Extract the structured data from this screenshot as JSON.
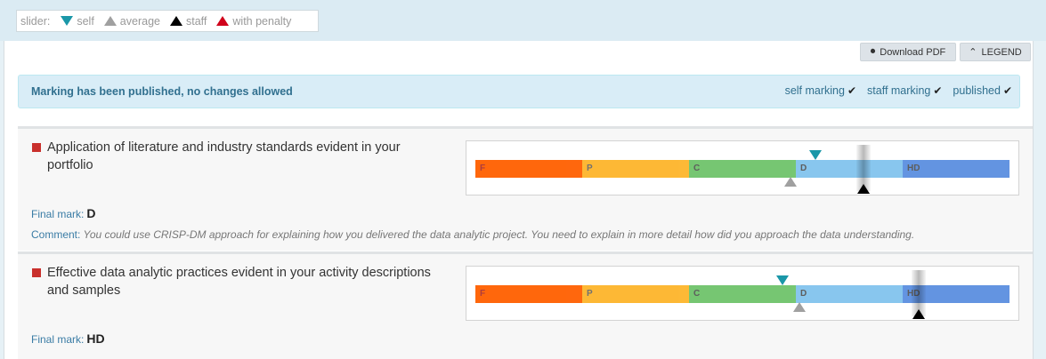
{
  "legend": {
    "label": "slider:",
    "items": [
      {
        "label": "self",
        "color": "#1a97a8",
        "dir": "down"
      },
      {
        "label": "average",
        "color": "#a0a0a0",
        "dir": "up"
      },
      {
        "label": "staff",
        "color": "#000000",
        "dir": "up"
      },
      {
        "label": "with penalty",
        "color": "#d0021b",
        "dir": "up"
      }
    ]
  },
  "toolbar": {
    "download_label": "Download PDF",
    "legend_label": "LEGEND"
  },
  "alert": {
    "message": "Marking has been published, no changes allowed",
    "status": [
      "self marking",
      "staff marking",
      "published"
    ]
  },
  "grade_bands": [
    "F",
    "P",
    "C",
    "D",
    "HD"
  ],
  "criteria": [
    {
      "title": "Application of literature and industry standards evident in your portfolio",
      "final_mark_label": "Final mark:",
      "final_mark": "D",
      "comment_label": "Comment:",
      "comment": "You could use CRISP-DM approach for explaining how you delivered the data analytic project. You need to explain in more detail how did you approach the data understanding."
    },
    {
      "title": "Effective data analytic practices evident in your activity descriptions and samples",
      "final_mark_label": "Final mark:",
      "final_mark": "HD"
    }
  ]
}
